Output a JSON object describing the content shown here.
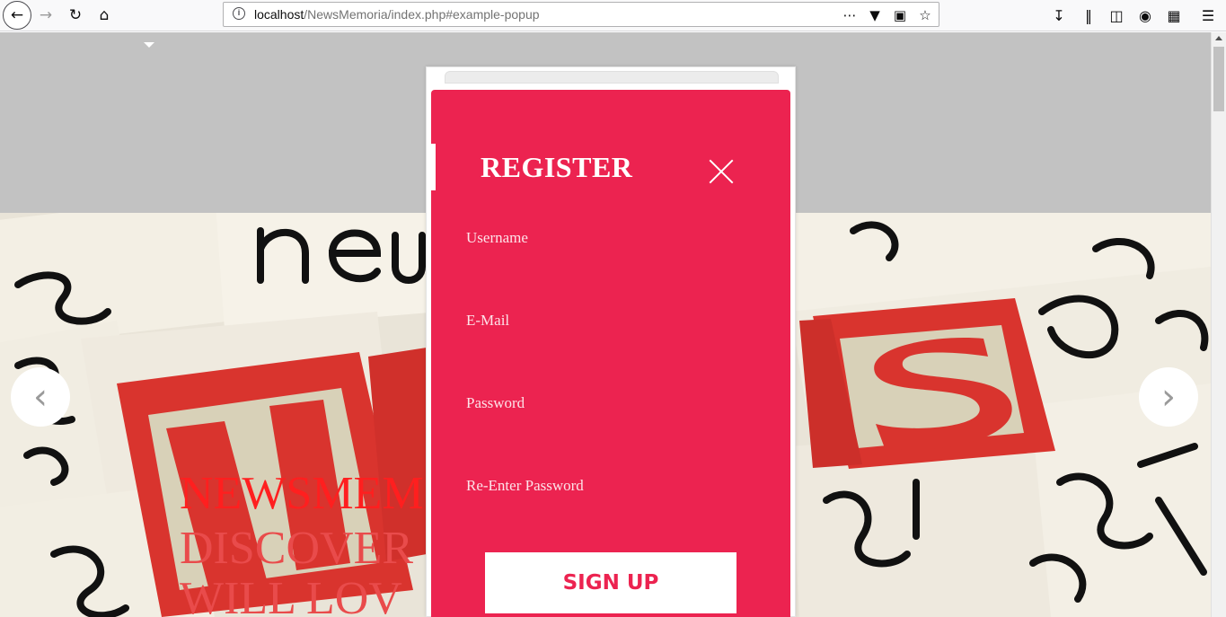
{
  "browser": {
    "url_host": "localhost",
    "url_path": "/NewsMemoria/index.php#example-popup",
    "icons": [
      "back-icon",
      "forward-icon",
      "reload-icon",
      "home-icon",
      "info-icon",
      "more-icon",
      "pocket-icon",
      "reader-view-icon",
      "bookmark-star-icon",
      "download-icon",
      "library-icon",
      "sidebar-icon",
      "private-icon",
      "screenshot-icon",
      "menu-icon"
    ]
  },
  "hero": {
    "title": "NEWSMEM",
    "subtitle_line1": "DISCOVER",
    "subtitle_line2": "WILL LOV"
  },
  "popup": {
    "title": "REGISTER",
    "fields": [
      {
        "placeholder": "Username"
      },
      {
        "placeholder": "E-Mail"
      },
      {
        "placeholder": "Password"
      },
      {
        "placeholder": "Re-Enter Password"
      }
    ],
    "submit_label": "SIGN UP"
  },
  "colors": {
    "popup_bg": "#ec2350",
    "hero_title": "#ff1f1f",
    "header_band": "#c2c2c2"
  }
}
